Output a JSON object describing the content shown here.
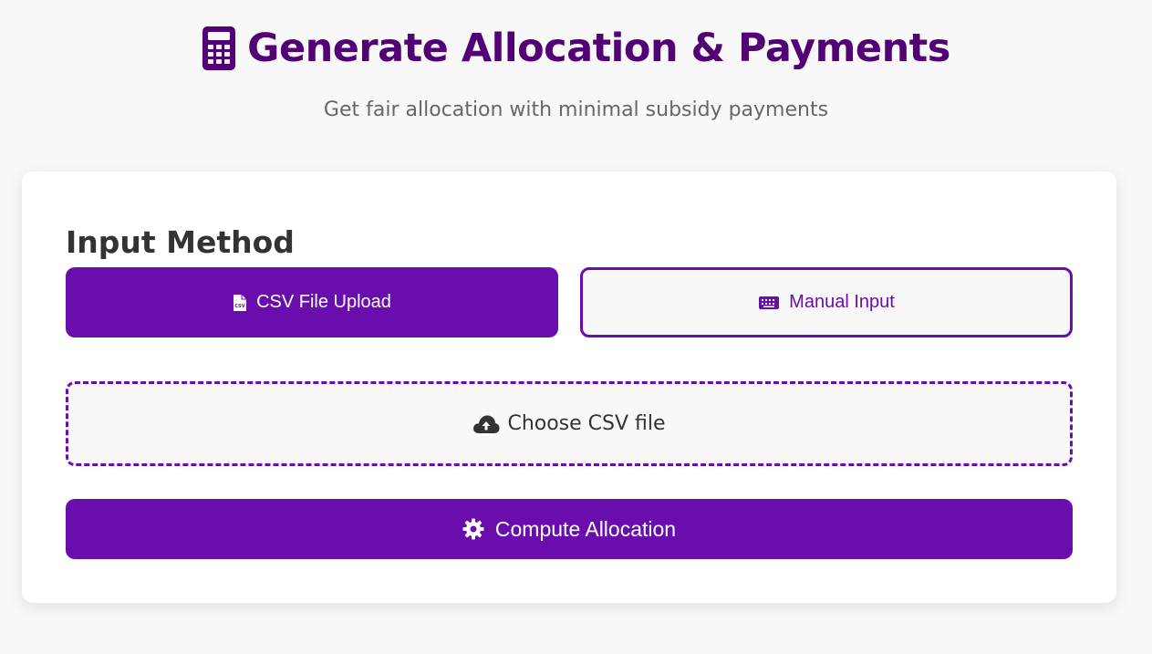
{
  "header": {
    "title": "Generate Allocation & Payments",
    "title_icon": "calculator-icon",
    "subtitle": "Get fair allocation with minimal subsidy payments"
  },
  "input_method": {
    "heading": "Input Method",
    "options": [
      {
        "label": "CSV File Upload",
        "icon": "csv-file-icon",
        "selected": true
      },
      {
        "label": "Manual Input",
        "icon": "keyboard-icon",
        "selected": false
      }
    ]
  },
  "upload": {
    "label": "Choose CSV file",
    "icon": "cloud-upload-icon"
  },
  "compute": {
    "label": "Compute Allocation",
    "icon": "gear-icon"
  },
  "colors": {
    "accent": "#6a0dad",
    "title": "#520275",
    "background": "#f8f8f8"
  }
}
